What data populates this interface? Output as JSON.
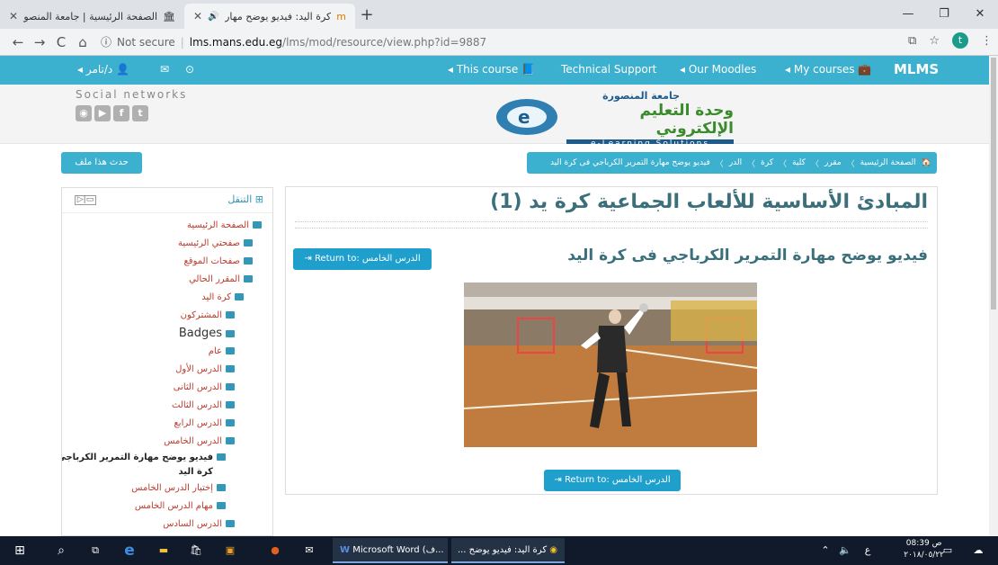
{
  "browser": {
    "tabs": [
      {
        "title": "الصفحة الرئيسية | جامعة المنصورة",
        "active": false
      },
      {
        "title": "كرة اليد: فيديو يوضح مهارة التم",
        "active": true
      }
    ],
    "url_label": "Not secure",
    "url_domain": "lms.mans.edu.eg",
    "url_path": "/lms/mod/resource/view.php?id=9887",
    "profile_initial": "t"
  },
  "topnav": {
    "user": "د/تامر",
    "this_course": "This course",
    "support": "Technical Support",
    "our_moodles": "Our Moodles",
    "my_courses": "My courses",
    "brand": "MLMS"
  },
  "header": {
    "social_title": "Social networks",
    "logo_line1": "جامعة المنصورة",
    "logo_line2": "وحدة التعليم الإلكتروني",
    "logo_line3": "e-Learning Solutions"
  },
  "breadcrumb": {
    "update_button": "حدث هذا ملف",
    "items": [
      "الصفحة الرئيسية",
      "مقرر",
      "كلية",
      "كرة",
      "الدر",
      "فيديو يوضح مهارة التمرير الكرباجي فى كرة اليد"
    ]
  },
  "sidebar": {
    "title": "التنقل",
    "nodes": [
      {
        "label": "الصفحة الرئيسية",
        "indent": 0
      },
      {
        "label": "صفحتي الرئيسية",
        "indent": 1
      },
      {
        "label": "صفحات الموقع",
        "indent": 1
      },
      {
        "label": "المقرر الحالي",
        "indent": 1
      },
      {
        "label": "كرة اليد",
        "indent": 2
      },
      {
        "label": "المشتركون",
        "indent": 3
      },
      {
        "label": "Badges",
        "indent": 3
      },
      {
        "label": "عام",
        "indent": 3
      },
      {
        "label": "الدرس الأول",
        "indent": 3
      },
      {
        "label": "الدرس الثانى",
        "indent": 3
      },
      {
        "label": "الدرس الثالث",
        "indent": 3
      },
      {
        "label": "الدرس الرابع",
        "indent": 3
      },
      {
        "label": "الدرس الخامس",
        "indent": 3
      },
      {
        "label": "فيديو يوضح مهارة التمرير الكرباجي فى",
        "indent": 4
      },
      {
        "label": "كرة اليد",
        "indent": 4
      },
      {
        "label": "إختبار الدرس الخامس",
        "indent": 4
      },
      {
        "label": "مهام الدرس الخامس",
        "indent": 4
      },
      {
        "label": "الدرس السادس",
        "indent": 3
      },
      {
        "label": "الدرس السابع",
        "indent": 3
      }
    ]
  },
  "main": {
    "title": "المبادئ الأساسية للألعاب الجماعية كرة يد (1)",
    "subtitle": "فيديو يوضح مهارة التمرير الكرباجي فى كرة اليد",
    "return_button": "Return to: الدرس الخامس"
  },
  "taskbar": {
    "word_app": "Microsoft Word (ف...",
    "chrome_app": "كرة اليد: فيديو يوضح ...",
    "lang": "ع",
    "time": "08:39 ص",
    "date": "٢٠١٨/٠٥/٢٢"
  },
  "colors": {
    "accent": "#3bb0cf",
    "title": "#3b6f7b",
    "link": "#c0392b"
  }
}
